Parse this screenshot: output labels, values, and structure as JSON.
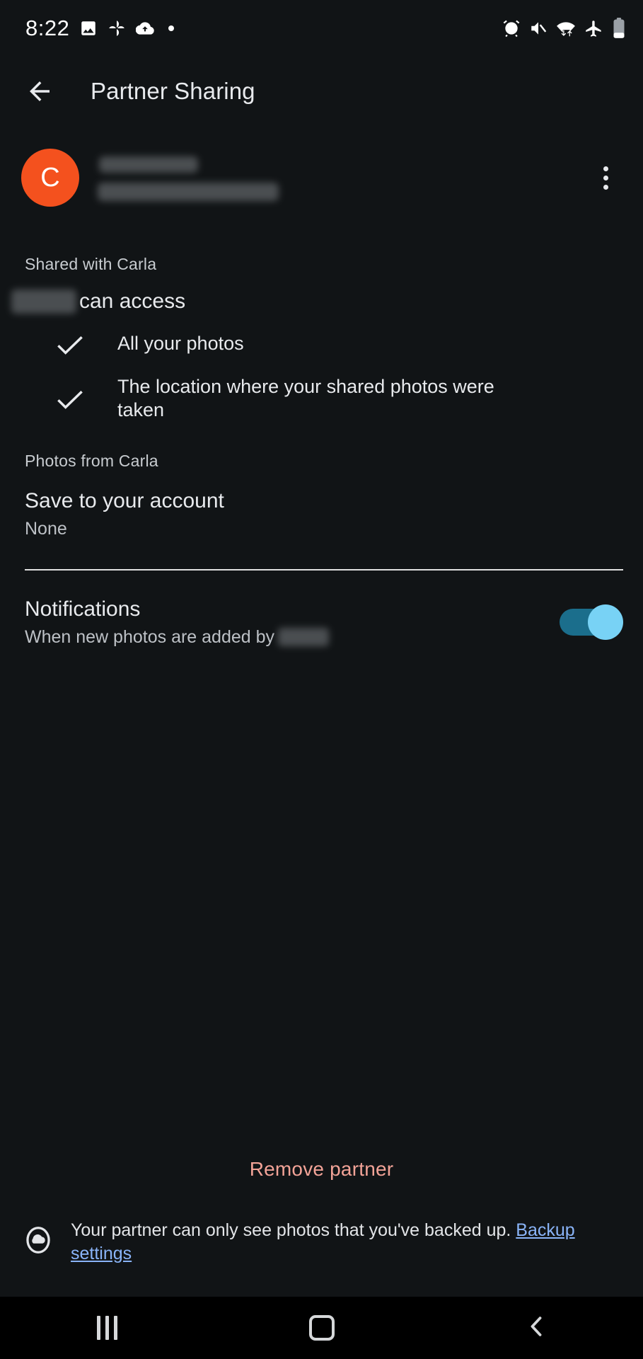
{
  "status_bar": {
    "time": "8:22",
    "left_icons": [
      "photo-icon",
      "pinwheel-icon",
      "cloud-sync-icon",
      "dot-indicator"
    ],
    "right_icons": [
      "alarm-icon",
      "mute-icon",
      "wifi-data-icon",
      "airplane-mode-icon",
      "battery-icon"
    ]
  },
  "appbar": {
    "back_label": "back-arrow",
    "title": "Partner Sharing"
  },
  "partner": {
    "avatar_initial": "C",
    "avatar_color": "#f4511e",
    "name_redacted": true,
    "email_redacted": true,
    "overflow_label": "more-options"
  },
  "shared_section": {
    "header": "Shared with Carla",
    "access_suffix": "can access",
    "access_name_redacted": true,
    "items": [
      {
        "label": "All your photos",
        "checked": true
      },
      {
        "label": "The location where your shared photos were taken",
        "checked": true
      }
    ]
  },
  "photos_from_section": {
    "header": "Photos from Carla",
    "save_title": "Save to your account",
    "save_value": "None"
  },
  "notifications": {
    "title": "Notifications",
    "subtitle_prefix": "When new photos are added by",
    "subtitle_name_redacted": true,
    "enabled": true,
    "toggle_on_color": "#78d2f5",
    "toggle_track_color": "#1b6e8c"
  },
  "actions": {
    "remove_partner": "Remove partner",
    "remove_partner_color": "#f2a397"
  },
  "footer": {
    "icon": "cloud-backup-icon",
    "text": "Your partner can only see photos that you've backed up.",
    "link_text": "Backup settings",
    "link_color": "#8ab4f8"
  },
  "navbar": {
    "recents": "recents-button",
    "home": "home-button",
    "back": "back-button"
  }
}
